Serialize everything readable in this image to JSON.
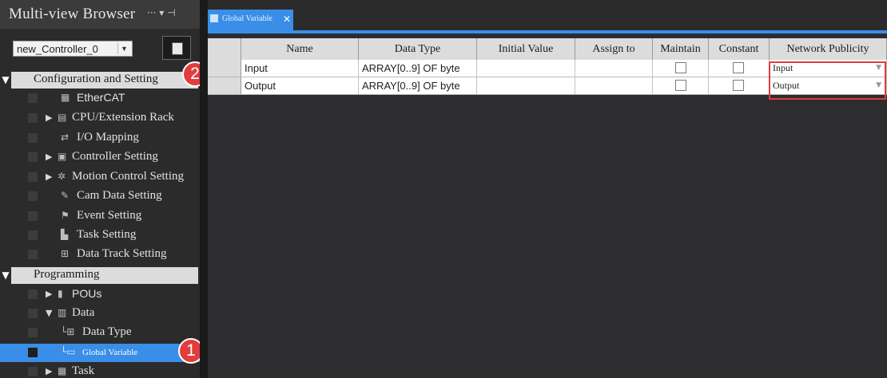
{
  "browser": {
    "title": "Multi-view Browser",
    "title_controls": "··· ▾ ⊣",
    "controller": "new_Controller_0",
    "sections": [
      {
        "label": "Configuration and Setting"
      },
      {
        "label": "Programming"
      }
    ],
    "config_items": [
      {
        "label": "EtherCAT",
        "icon": "ethercat-icon"
      },
      {
        "label": "CPU/Extension Rack",
        "icon": "rack-icon"
      },
      {
        "label": "I/O Mapping",
        "icon": "io-mapping-icon"
      },
      {
        "label": "Controller Setting",
        "icon": "controller-setting-icon"
      },
      {
        "label": "Motion Control Setting",
        "icon": "motion-setting-icon"
      },
      {
        "label": "Cam Data Setting",
        "icon": "cam-data-icon"
      },
      {
        "label": "Event Setting",
        "icon": "event-setting-icon"
      },
      {
        "label": "Task Setting",
        "icon": "task-setting-icon"
      },
      {
        "label": "Data Track Setting",
        "icon": "data-track-icon"
      }
    ],
    "programming_items": [
      {
        "label": "POUs",
        "icon": "pous-icon"
      },
      {
        "label": "Data",
        "icon": "data-icon"
      },
      {
        "label": "Data Type",
        "icon": "data-type-icon"
      },
      {
        "label": "Global Variable",
        "icon": "global-variable-icon"
      },
      {
        "label": "Task",
        "icon": "task-icon"
      }
    ]
  },
  "badges": {
    "one": "1",
    "two": "2"
  },
  "editor": {
    "tab_label": "Global Variable",
    "columns": [
      "Name",
      "Data Type",
      "Initial Value",
      "Assign to",
      "Maintain",
      "Constant",
      "Network Publicity"
    ],
    "rows": [
      {
        "name": "Input",
        "data_type": "ARRAY[0..9] OF byte",
        "initial_value": "",
        "assign_to": "",
        "maintain": false,
        "constant": false,
        "network_publicity": "Input"
      },
      {
        "name": "Output",
        "data_type": "ARRAY[0..9] OF byte",
        "initial_value": "",
        "assign_to": "",
        "maintain": false,
        "constant": false,
        "network_publicity": "Output"
      }
    ]
  },
  "colors": {
    "accent": "#3a8ee8",
    "badge": "#e23c3c",
    "highlight": "#e23c3c"
  }
}
